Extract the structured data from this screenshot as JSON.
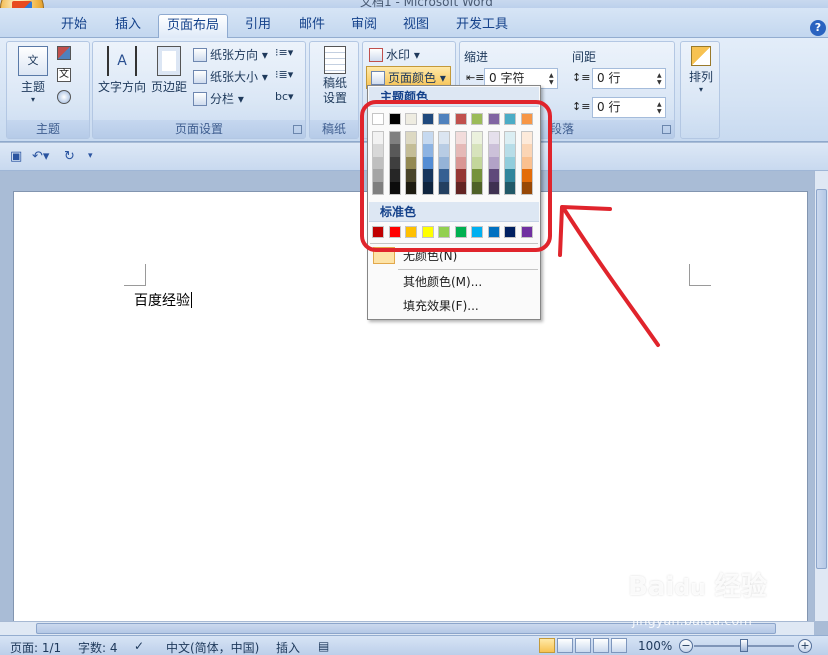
{
  "window": {
    "title": "文档1 - Microsoft Word"
  },
  "tabs": [
    {
      "label": "开始"
    },
    {
      "label": "插入"
    },
    {
      "label": "页面布局",
      "active": true
    },
    {
      "label": "引用"
    },
    {
      "label": "邮件"
    },
    {
      "label": "审阅"
    },
    {
      "label": "视图"
    },
    {
      "label": "开发工具"
    }
  ],
  "ribbon": {
    "theme_group": {
      "label": "主题",
      "button": "主题"
    },
    "page_setup_group": {
      "label": "页面设置",
      "text_direction": "文字方向",
      "margins": "页边距",
      "orientation": "纸张方向",
      "size": "纸张大小",
      "columns": "分栏"
    },
    "draft_group": {
      "label": "稿纸",
      "button_line1": "稿纸",
      "button_line2": "设置"
    },
    "background_group": {
      "watermark": "水印",
      "page_color": "页面颜色"
    },
    "paragraph_group": {
      "label": "段落",
      "indent_title": "缩进",
      "spacing_title": "间距",
      "indent_left_value": "0 字符",
      "spacing_before_value": "0 行",
      "spacing_after_value": "0 行"
    },
    "arrange_group": {
      "button": "排列"
    }
  },
  "page_color_menu": {
    "theme_colors_title": "主题颜色",
    "standard_colors_title": "标准色",
    "no_color": "无颜色(N)",
    "more_colors": "其他颜色(M)...",
    "fill_effects": "填充效果(F)...",
    "theme_top_row": [
      "#ffffff",
      "#000000",
      "#eeece1",
      "#1f497d",
      "#4f81bd",
      "#c0504d",
      "#9bbb59",
      "#8064a2",
      "#4bacc6",
      "#f79646"
    ],
    "theme_shades": [
      [
        "#f2f2f2",
        "#d8d8d8",
        "#bfbfbf",
        "#a5a5a5",
        "#7f7f7f"
      ],
      [
        "#7f7f7f",
        "#595959",
        "#3f3f3f",
        "#262626",
        "#0c0c0c"
      ],
      [
        "#ddd9c3",
        "#c4bd97",
        "#938953",
        "#494429",
        "#1d1b10"
      ],
      [
        "#c6d9f0",
        "#8db3e2",
        "#548dd4",
        "#17365d",
        "#0f243e"
      ],
      [
        "#dbe5f1",
        "#b8cce4",
        "#95b3d7",
        "#366092",
        "#244061"
      ],
      [
        "#f2dcdb",
        "#e5b9b7",
        "#d99694",
        "#953734",
        "#632423"
      ],
      [
        "#ebf1dd",
        "#d7e3bc",
        "#c3d69b",
        "#76923c",
        "#4f6128"
      ],
      [
        "#e5e0ec",
        "#ccc1d9",
        "#b2a2c7",
        "#5f497a",
        "#3f3151"
      ],
      [
        "#dbeef3",
        "#b7dde8",
        "#92cddc",
        "#31859b",
        "#205867"
      ],
      [
        "#fdeada",
        "#fbd5b5",
        "#fac08f",
        "#e36c09",
        "#974806"
      ]
    ],
    "standard_row": [
      "#c00000",
      "#ff0000",
      "#ffc000",
      "#ffff00",
      "#92d050",
      "#00b050",
      "#00b0f0",
      "#0070c0",
      "#002060",
      "#7030a0"
    ]
  },
  "document": {
    "text": "百度经验"
  },
  "status_bar": {
    "page": "页面: 1/1",
    "words": "字数: 4",
    "language": "中文(简体，中国)",
    "mode": "插入",
    "zoom": "100%"
  },
  "watermark": {
    "brand": "Baidu 经验",
    "url": "jingyan.baidu.com"
  },
  "annotation_color": "#e0242c"
}
